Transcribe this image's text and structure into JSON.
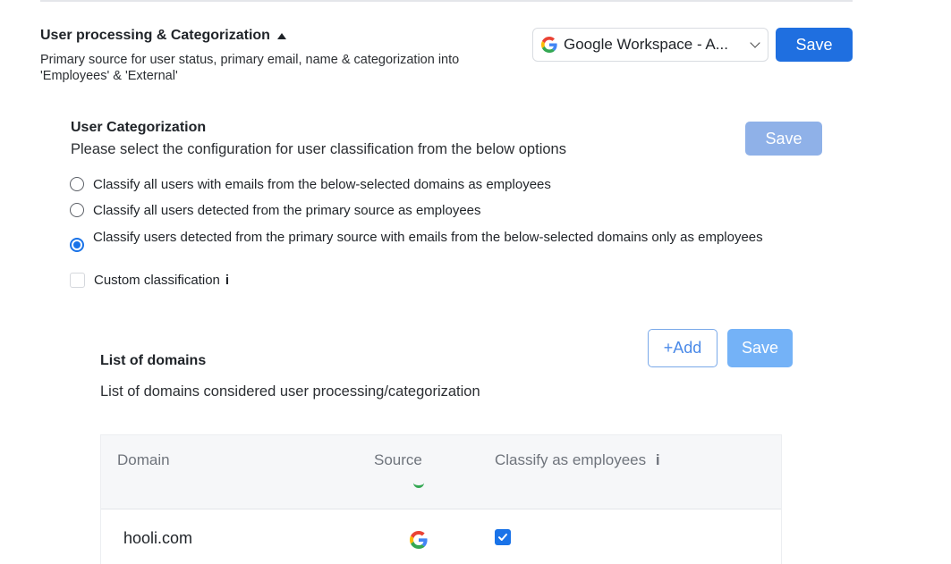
{
  "section": {
    "title": "User processing & Categorization",
    "description": "Primary source for user status, primary email, name & categorization into 'Employees' & 'External'",
    "source_select": "Google Workspace - A...",
    "save_label": "Save"
  },
  "categorization": {
    "title": "User Categorization",
    "description": "Please select the configuration for user classification from the below options",
    "save_label": "Save",
    "options": [
      {
        "label": "Classify all users with emails from the below-selected domains as employees",
        "selected": false
      },
      {
        "label": "Classify all users detected from the primary source as employees",
        "selected": false
      },
      {
        "label": "Classify users detected from the primary source with emails from the below-selected domains only as employees",
        "selected": true
      }
    ],
    "custom": {
      "label": "Custom classification",
      "info": "i",
      "checked": false
    }
  },
  "domains": {
    "title": "List of domains",
    "description": "List of domains considered user processing/categorization",
    "add_label": "+Add",
    "save_label": "Save",
    "columns": {
      "domain": "Domain",
      "source": "Source",
      "classify": "Classify as employees",
      "classify_info": "i"
    },
    "rows": [
      {
        "domain": "hooli.com",
        "source_icon": "google-icon",
        "classify": true
      }
    ]
  },
  "colors": {
    "primary": "#1f6fe0",
    "disabled": "#8fb1e8",
    "accent": "#1a73e8"
  }
}
